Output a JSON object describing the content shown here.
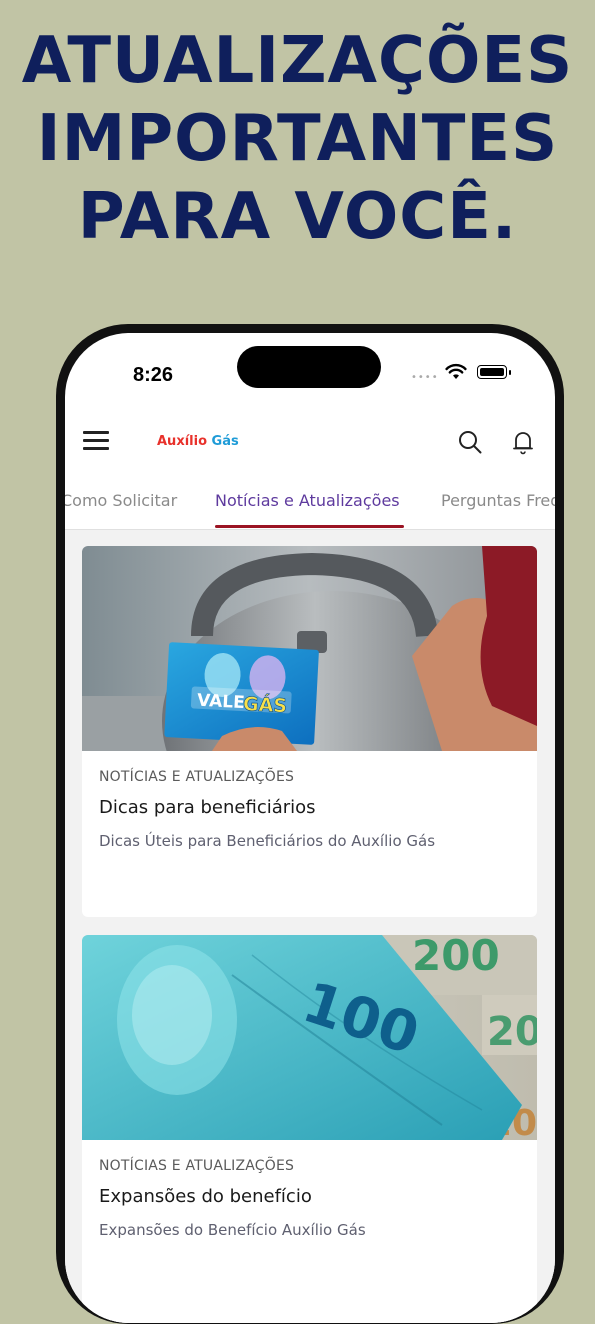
{
  "headline": {
    "line1": "ATUALIZAÇÕES",
    "line2": "IMPORTANTES",
    "line3": "PARA VOCÊ."
  },
  "statusbar": {
    "time": "8:26"
  },
  "appbar": {
    "logo_part1": "Auxílio",
    "logo_part2": "Gás"
  },
  "tabs": [
    {
      "label": "Como Solicitar"
    },
    {
      "label": "Notícias e Atualizações"
    },
    {
      "label": "Perguntas Frequentes"
    }
  ],
  "cards": [
    {
      "image_alt": "vale-gas-card-image",
      "image_text": "VALE GÁS",
      "category": "NOTÍCIAS E ATUALIZAÇÕES",
      "title": "Dicas para beneficiários",
      "description": "Dicas Úteis para Beneficiários do Auxílio Gás"
    },
    {
      "image_alt": "money-banknotes-image",
      "image_text_100": "100",
      "image_text_200": "200",
      "image_text_20": "20",
      "category": "NOTÍCIAS E ATUALIZAÇÕES",
      "title": "Expansões do benefício",
      "description": "Expansões do Benefício Auxílio Gás"
    }
  ],
  "colors": {
    "background": "#c1c4a5",
    "headline": "#0f1f5c",
    "active_tab": "#5e3a9e",
    "tab_indicator": "#9b1423",
    "logo_red": "#e8312b",
    "logo_blue": "#1e9bd7"
  }
}
